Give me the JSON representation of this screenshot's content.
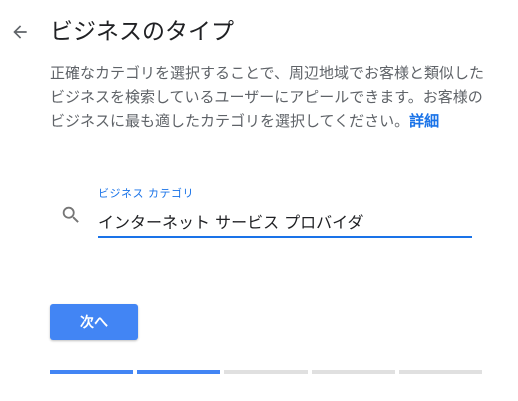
{
  "header": {
    "back_icon": "arrow-back-icon",
    "title": "ビジネスのタイプ"
  },
  "description": {
    "text": "正確なカテゴリを選択することで、周辺地域でお客様と類似したビジネスを検索しているユーザーにアピールできます。お客様のビジネスに最も適したカテゴリを選択してください。",
    "link": "詳細"
  },
  "category_field": {
    "icon": "search-icon",
    "label": "ビジネス カテゴリ",
    "value": "インターネット サービス プロバイダ"
  },
  "actions": {
    "next_label": "次へ"
  },
  "progress": {
    "total_steps": 5,
    "completed_steps": 2
  },
  "colors": {
    "accent": "#1a73e8",
    "button": "#4285f4",
    "progress_done": "#4285f4",
    "progress_todo": "#e0e0e0",
    "text_primary": "#202124",
    "text_secondary": "#5f6368"
  }
}
